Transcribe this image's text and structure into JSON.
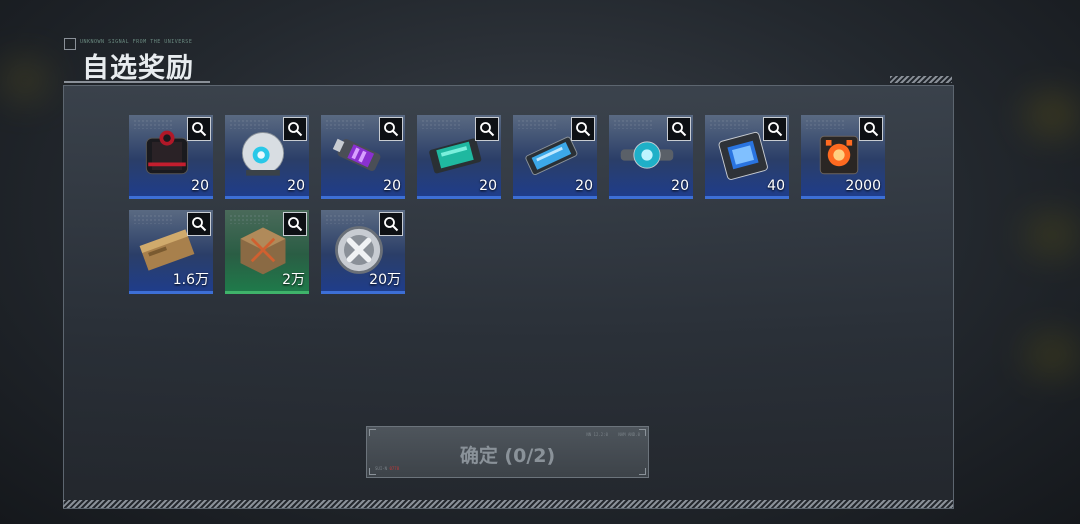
{
  "header": {
    "subtitle": "UNKNOWN SIGNAL FROM THE UNIVERSE",
    "title": "自选奖励"
  },
  "rewards": [
    {
      "qty": "20",
      "icon": "red-black-crate-icon",
      "rarity": "blue"
    },
    {
      "qty": "20",
      "icon": "white-sphere-drone-icon",
      "rarity": "blue"
    },
    {
      "qty": "20",
      "icon": "purple-energy-canister-icon",
      "rarity": "blue"
    },
    {
      "qty": "20",
      "icon": "teal-battery-pack-icon",
      "rarity": "blue"
    },
    {
      "qty": "20",
      "icon": "blue-data-cartridge-icon",
      "rarity": "blue"
    },
    {
      "qty": "20",
      "icon": "cyan-orb-module-icon",
      "rarity": "blue"
    },
    {
      "qty": "40",
      "icon": "blue-screen-device-icon",
      "rarity": "blue"
    },
    {
      "qty": "2000",
      "icon": "orange-glow-cube-icon",
      "rarity": "blue"
    },
    {
      "qty": "1.6万",
      "icon": "bronze-ingot-icon",
      "rarity": "blue"
    },
    {
      "qty": "2万",
      "icon": "bronze-cube-icon",
      "rarity": "green"
    },
    {
      "qty": "20万",
      "icon": "silver-x-coin-icon",
      "rarity": "blue"
    }
  ],
  "confirm_button": {
    "label": "确定 (0/2)",
    "code_left": "SUI-N",
    "code_left_red": "0778",
    "code_tr1": "NN 12.2:0",
    "code_tr2": "NAM AND.0"
  },
  "colors": {
    "rarity_blue": "#3d6fd6",
    "rarity_green": "#3fb36a"
  }
}
